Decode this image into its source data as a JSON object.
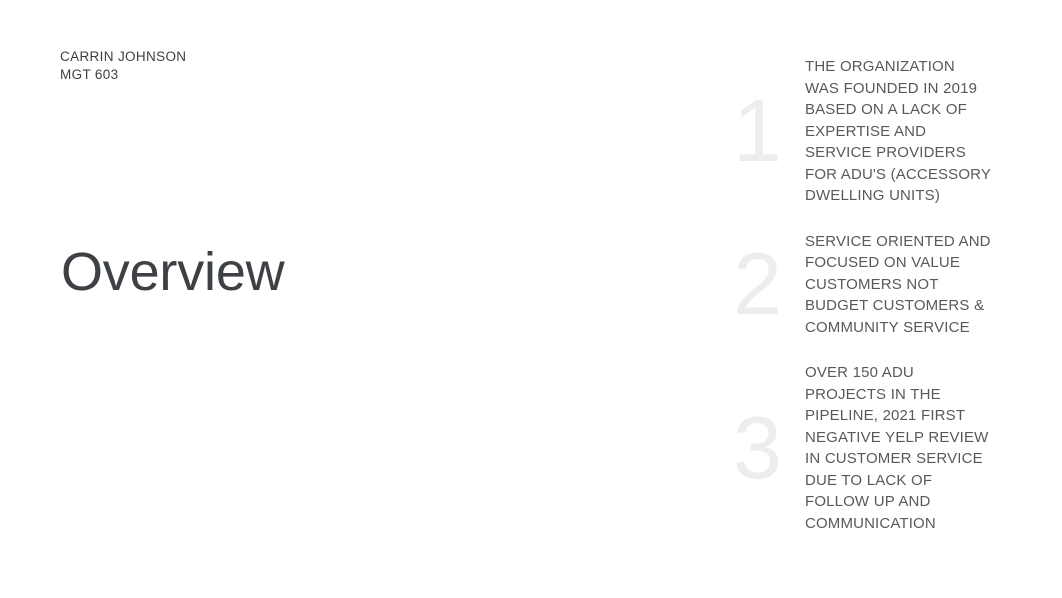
{
  "slide": {
    "background_color": "#ffffff",
    "title": "Overview",
    "title_color": "#3d4145",
    "byline": [
      "CARRIN JOHNSON",
      "MGT 603"
    ],
    "byline_color": "#404040"
  },
  "points": {
    "number_color": "#ededed",
    "text_color": "#595959",
    "items": [
      {
        "number": "1",
        "text": "THE ORGANIZATION WAS FOUNDED IN 2019 BASED ON A LACK OF EXPERTISE AND SERVICE PROVIDERS FOR ADU'S (ACCESSORY DWELLING UNITS)"
      },
      {
        "number": "2",
        "text": "SERVICE ORIENTED AND FOCUSED ON VALUE CUSTOMERS NOT BUDGET CUSTOMERS & COMMUNITY SERVICE"
      },
      {
        "number": "3",
        "text": "OVER 150 ADU PROJECTS IN THE PIPELINE, 2021 FIRST NEGATIVE YELP REVIEW IN CUSTOMER SERVICE DUE TO LACK OF FOLLOW UP AND COMMUNICATION"
      }
    ]
  }
}
